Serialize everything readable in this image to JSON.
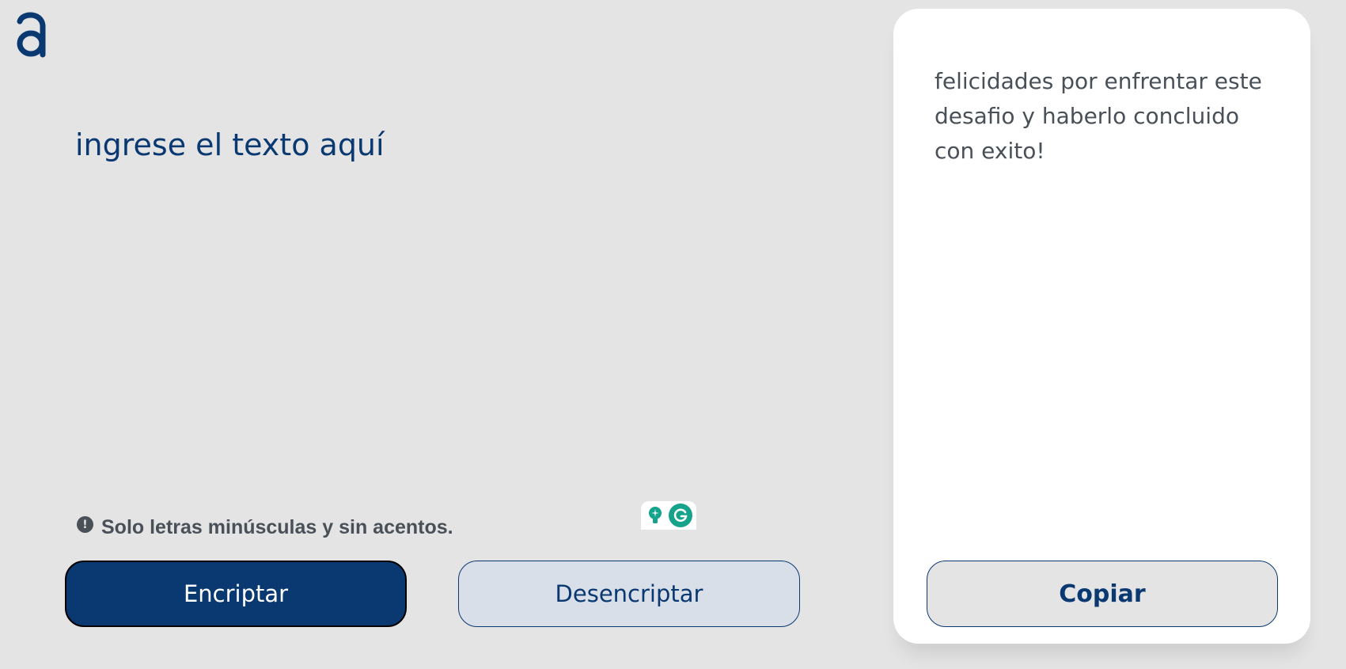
{
  "logo": {
    "icon": "alura-logo-icon"
  },
  "input": {
    "placeholder": "ingrese el texto aquí",
    "value": ""
  },
  "hint": {
    "icon": "exclamation-circle-icon",
    "text": "Solo letras minúsculas y sin acentos."
  },
  "buttons": {
    "encrypt_label": "Encriptar",
    "decrypt_label": "Desencriptar"
  },
  "grammarly": {
    "icons": [
      "grammarly-bulb-icon",
      "grammarly-g-icon"
    ]
  },
  "output": {
    "text": "felicidades por enfrentar este desafio y haberlo concluido con exito!",
    "copy_label": "Copiar"
  },
  "colors": {
    "background": "#e4e4e5",
    "primary": "#0a3871",
    "secondary_button": "#d8dfe8",
    "text_gray": "#495057",
    "panel": "#ffffff",
    "grammarly": "#15a38b"
  }
}
